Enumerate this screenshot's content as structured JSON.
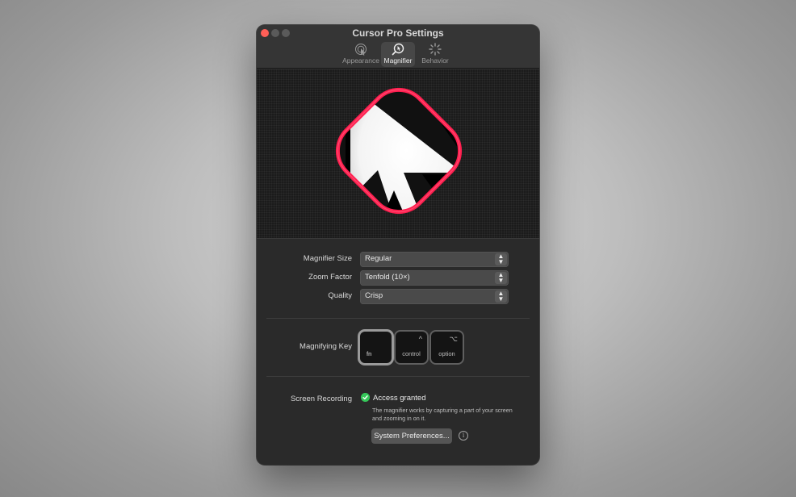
{
  "window": {
    "title": "Cursor Pro Settings"
  },
  "tabs": [
    {
      "label": "Appearance",
      "icon": "cursor-touch-icon"
    },
    {
      "label": "Magnifier",
      "icon": "magnifier-icon",
      "selected": true
    },
    {
      "label": "Behavior",
      "icon": "spinner-icon"
    }
  ],
  "settings": {
    "magnifier_size": {
      "label": "Magnifier Size",
      "value": "Regular"
    },
    "zoom_factor": {
      "label": "Zoom Factor",
      "value": "Tenfold (10×)"
    },
    "quality": {
      "label": "Quality",
      "value": "Crisp"
    }
  },
  "magnifying_key": {
    "label": "Magnifying Key",
    "keys": [
      {
        "label": "fn",
        "symbol": "",
        "selected": true
      },
      {
        "label": "control",
        "symbol": "^",
        "selected": false
      },
      {
        "label": "option",
        "symbol": "⌥",
        "selected": false
      }
    ]
  },
  "screen_recording": {
    "label": "Screen Recording",
    "status": "Access granted",
    "description": "The magnifier works by capturing a part of your screen and zooming in on it.",
    "button": "System Preferences...",
    "info_symbol": "i"
  },
  "colors": {
    "magnifier_ring": "#ff1f4f",
    "check": "#35c759",
    "close": "#ff5f57"
  }
}
